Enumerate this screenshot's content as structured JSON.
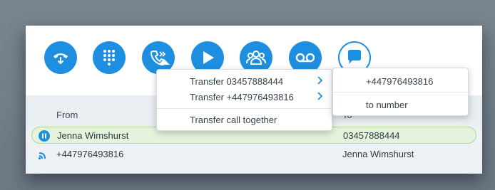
{
  "toolbar": {
    "buttons": [
      {
        "icon": "hangup-icon"
      },
      {
        "icon": "dialpad-icon"
      },
      {
        "icon": "transfer-icon"
      },
      {
        "icon": "play-icon"
      },
      {
        "icon": "conference-icon"
      },
      {
        "icon": "voicemail-icon"
      },
      {
        "icon": "chat-icon"
      }
    ],
    "accent": "#1e8fe0"
  },
  "table": {
    "headers": {
      "from": "From",
      "to": "To"
    },
    "rows": [
      {
        "from": "Jenna Wimshurst",
        "to": "03457888444",
        "status": "on-hold",
        "active": true
      },
      {
        "from": "+447976493816",
        "to": "Jenna Wimshurst",
        "status": "ringing",
        "active": false
      }
    ]
  },
  "transfer_menu": {
    "items": [
      {
        "label": "Transfer 03457888444",
        "has_submenu": true
      },
      {
        "label": "Transfer +447976493816",
        "has_submenu": true
      },
      {
        "label": "Transfer call together",
        "has_submenu": false
      }
    ]
  },
  "submenu": {
    "items": [
      {
        "label": "+447976493816"
      },
      {
        "label": "to number"
      }
    ]
  }
}
